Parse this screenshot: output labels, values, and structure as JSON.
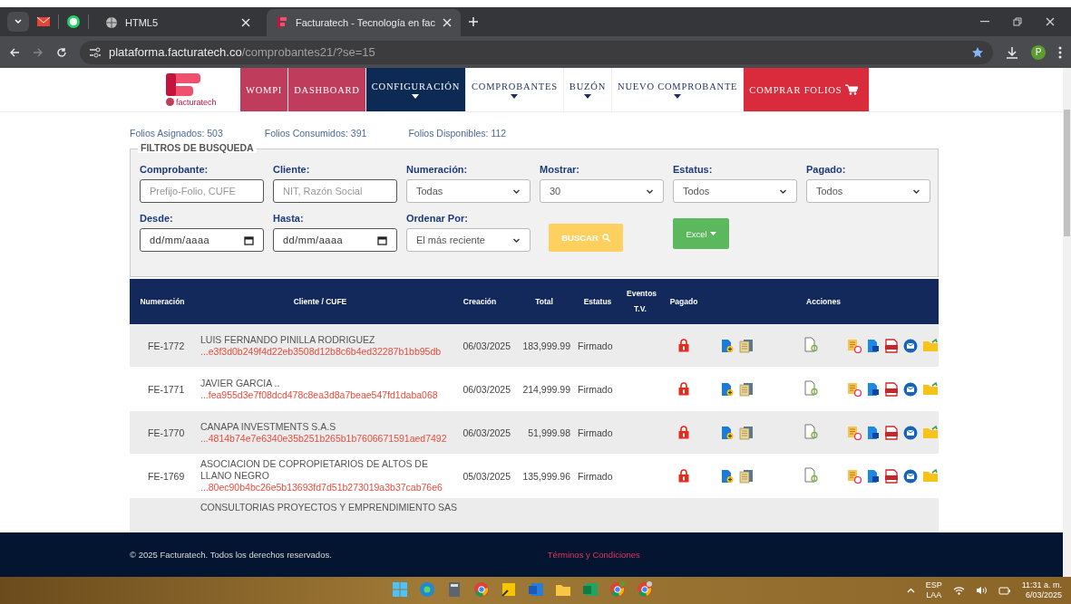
{
  "browser": {
    "tabs": [
      {
        "title": "HTML5",
        "selected": false
      },
      {
        "title": "Facturatech - Tecnología en fac",
        "selected": true
      }
    ],
    "url_host": "plataforma.facturatech.co",
    "url_path": "/comprobantes21/?se=15",
    "profile": "P"
  },
  "nav": {
    "logo_text": "facturatech",
    "items": [
      {
        "label": "WOMPI",
        "kind": "highlight",
        "dropdown": false,
        "selected": false
      },
      {
        "label": "DASHBOARD",
        "kind": "highlight",
        "dropdown": false,
        "selected": false
      },
      {
        "label": "CONFIGURACIÓN",
        "kind": "menu",
        "dropdown": true,
        "selected": true
      },
      {
        "label": "COMPROBANTES",
        "kind": "menu",
        "dropdown": true,
        "selected": false
      },
      {
        "label": "BUZÓN",
        "kind": "menu",
        "dropdown": true,
        "selected": false
      },
      {
        "label": "NUEVO COMPROBANTE",
        "kind": "menu",
        "dropdown": true,
        "selected": false
      },
      {
        "label": "COMPRAR FOLIOS",
        "kind": "cta",
        "dropdown": false,
        "selected": false
      }
    ]
  },
  "folios": [
    "Folios Asignados: 503",
    "Folios Consumidos: 391",
    "Folios Disponibles: 112"
  ],
  "filters": {
    "legend": "FILTROS DE BUSQUEDA",
    "fields": [
      {
        "label": "Comprobante:",
        "kind": "text",
        "placeholder": "Prefijo-Folio, CUFE"
      },
      {
        "label": "Cliente:",
        "kind": "text",
        "placeholder": "NIT, Razón Social"
      },
      {
        "label": "Numeración:",
        "kind": "select",
        "value": "Todas"
      },
      {
        "label": "Mostrar:",
        "kind": "select",
        "value": "30"
      },
      {
        "label": "Estatus:",
        "kind": "select",
        "value": "Todos"
      },
      {
        "label": "Pagado:",
        "kind": "select",
        "value": "Todos"
      },
      {
        "label": "Desde:",
        "kind": "date",
        "placeholder": "dd/mm/aaaa"
      },
      {
        "label": "Hasta:",
        "kind": "date",
        "placeholder": "dd/mm/aaaa"
      },
      {
        "label": "Ordenar Por:",
        "kind": "select",
        "value": "El más reciente"
      }
    ],
    "search_button": "BUSCAR",
    "excel_button": "Excel"
  },
  "table": {
    "columns": [
      "Numeración",
      "Cliente / CUFE",
      "Creación",
      "Total",
      "Estatus",
      "Eventos T.V.",
      "Pagado",
      "Acciones"
    ],
    "rows": [
      {
        "numeracion": "FE-1772",
        "cliente": "LUIS FERNANDO PINILLA RODRIGUEZ",
        "cufe": "...e3f3d0b249f4d22eb3508d12b8c6b4ed32287b1bb95db",
        "creacion": "06/03/2025",
        "total": "183,999.99",
        "estatus": "Firmado",
        "paid": false
      },
      {
        "numeracion": "FE-1771",
        "cliente": "JAVIER GARCIA ..",
        "cufe": "...fea955d3e7f08dcd478c8ea3d8a7beae547fd1daba068",
        "creacion": "06/03/2025",
        "total": "214,999.99",
        "estatus": "Firmado",
        "paid": false
      },
      {
        "numeracion": "FE-1770",
        "cliente": "CANAPA INVESTMENTS S.A.S",
        "cufe": "...4814b74e7e6340e35b251b265b1b7606671591aed7492",
        "creacion": "06/03/2025",
        "total": "51,999.98",
        "estatus": "Firmado",
        "paid": false
      },
      {
        "numeracion": "FE-1769",
        "cliente": "ASOCIACION DE COPROPIETARIOS DE ALTOS DE LLANO NEGRO",
        "cufe": "...80ec90b4bc26e5b13693fd7d51b273019a3b37cab76e6",
        "creacion": "05/03/2025",
        "total": "135,999.96",
        "estatus": "Firmado",
        "paid": false
      },
      {
        "cliente": "CONSULTORIAS PROYECTOS Y EMPRENDIMIENTO SAS"
      }
    ]
  },
  "footer": {
    "copyright": "© 2025 Facturatech. Todos los derechos reservados.",
    "terms_link": "Términos y Condiciones"
  },
  "taskbar": {
    "language": "ESP",
    "layout": "LAA",
    "time": "11:31 a. m.",
    "date": "6/03/2025"
  }
}
